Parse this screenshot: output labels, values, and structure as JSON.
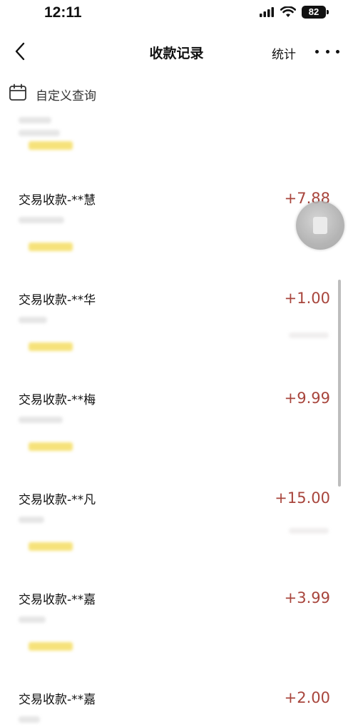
{
  "status_bar": {
    "time": "12:11",
    "battery": "82",
    "icons": [
      "signal-icon",
      "wifi-icon",
      "battery-icon"
    ]
  },
  "nav": {
    "title": "收款记录",
    "right_label": "统计",
    "icons": [
      "back-chevron-icon",
      "more-icon"
    ]
  },
  "filter": {
    "label": "自定义查询",
    "icon": "calendar-icon"
  },
  "records": [
    {
      "title": "交易收款-**慧",
      "amount": "+7.88"
    },
    {
      "title": "交易收款-**华",
      "amount": "+1.00"
    },
    {
      "title": "交易收款-**梅",
      "amount": "+9.99"
    },
    {
      "title": "交易收款-**凡",
      "amount": "+15.00"
    },
    {
      "title": "交易收款-**嘉",
      "amount": "+3.99"
    },
    {
      "title": "交易收款-**嘉",
      "amount": "+2.00"
    }
  ],
  "colors": {
    "amount": "#a8453c",
    "tag_highlight": "#f6e27a",
    "text": "#111111"
  }
}
